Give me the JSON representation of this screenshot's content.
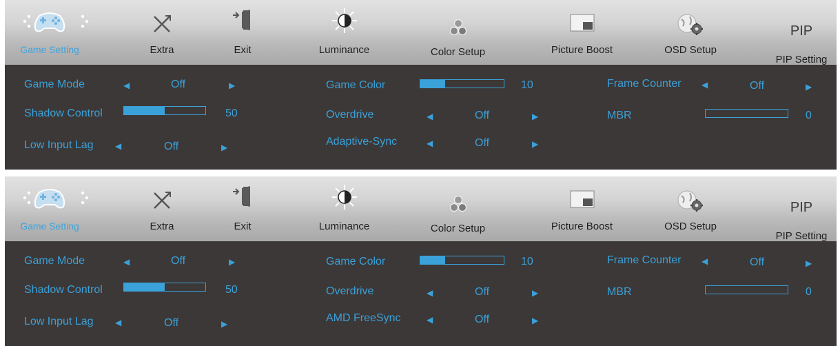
{
  "panels": [
    {
      "tabs": {
        "game": "Game Setting",
        "extra": "Extra",
        "exit": "Exit",
        "lum": "Luminance",
        "color": "Color Setup",
        "boost": "Picture Boost",
        "osd": "OSD Setup",
        "pip_big": "PIP",
        "pip": "PIP Setting"
      },
      "settings": {
        "game_mode": {
          "label": "Game Mode",
          "value": "Off"
        },
        "shadow": {
          "label": "Shadow Control",
          "value": "50",
          "level": 0.5
        },
        "low_lag": {
          "label": "Low Input Lag",
          "value": "Off"
        },
        "game_color": {
          "label": "Game Color",
          "value": "10",
          "level": 0.3
        },
        "overdrive": {
          "label": "Overdrive",
          "value": "Off"
        },
        "sync": {
          "label": "Adaptive-Sync",
          "value": "Off"
        },
        "frame": {
          "label": "Frame Counter",
          "value": "Off"
        },
        "mbr": {
          "label": "MBR",
          "value": "0",
          "level": 0
        }
      }
    },
    {
      "tabs": {
        "game": "Game Setting",
        "extra": "Extra",
        "exit": "Exit",
        "lum": "Luminance",
        "color": "Color Setup",
        "boost": "Picture Boost",
        "osd": "OSD Setup",
        "pip_big": "PIP",
        "pip": "PIP Setting"
      },
      "settings": {
        "game_mode": {
          "label": "Game Mode",
          "value": "Off"
        },
        "shadow": {
          "label": "Shadow Control",
          "value": "50",
          "level": 0.5
        },
        "low_lag": {
          "label": "Low Input Lag",
          "value": "Off"
        },
        "game_color": {
          "label": "Game Color",
          "value": "10",
          "level": 0.3
        },
        "overdrive": {
          "label": "Overdrive",
          "value": "Off"
        },
        "sync": {
          "label": "AMD FreeSync",
          "value": "Off"
        },
        "frame": {
          "label": "Frame Counter",
          "value": "Off"
        },
        "mbr": {
          "label": "MBR",
          "value": "0",
          "level": 0
        }
      }
    }
  ],
  "icons": [
    "chevron-left-icon",
    "gamepad-icon",
    "chevron-right-icon",
    "tools-icon",
    "exit-door-icon",
    "sun-contrast-icon",
    "color-circles-icon",
    "picture-boost-icon",
    "osd-globe-gear-icon"
  ],
  "colors": {
    "accent": "#3aa1d9",
    "panel": "#3c3837",
    "tabbar": "#c4c4c4",
    "tab_text": "#1f1f1f"
  }
}
